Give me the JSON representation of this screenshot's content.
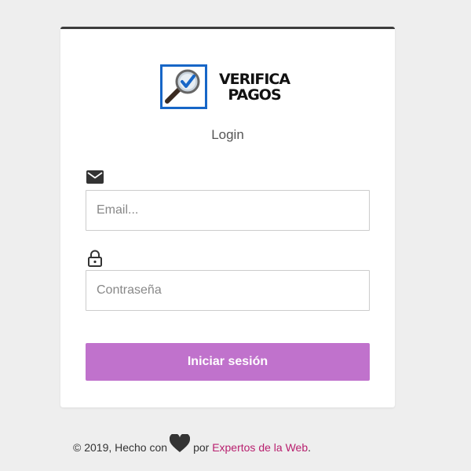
{
  "logo": {
    "line1": "VERIFICA",
    "line2": "PAGOS",
    "icon": "magnifier-checkmark-icon"
  },
  "login": {
    "title": "Login",
    "email": {
      "icon": "envelope-icon",
      "placeholder": "Email...",
      "value": ""
    },
    "password": {
      "icon": "lock-icon",
      "placeholder": "Contraseña",
      "value": ""
    },
    "submit_label": "Iniciar sesión"
  },
  "footer": {
    "prefix": "© 2019, Hecho con",
    "heart_icon": "heart-icon",
    "middle": "por",
    "link_text": "Expertos de la Web",
    "suffix": "."
  },
  "colors": {
    "background": "#eeeeee",
    "card": "#ffffff",
    "card_top_border": "#3c3c3c",
    "button": "#c072cc",
    "link": "#b81f6e",
    "logo_blue": "#1766c7"
  }
}
